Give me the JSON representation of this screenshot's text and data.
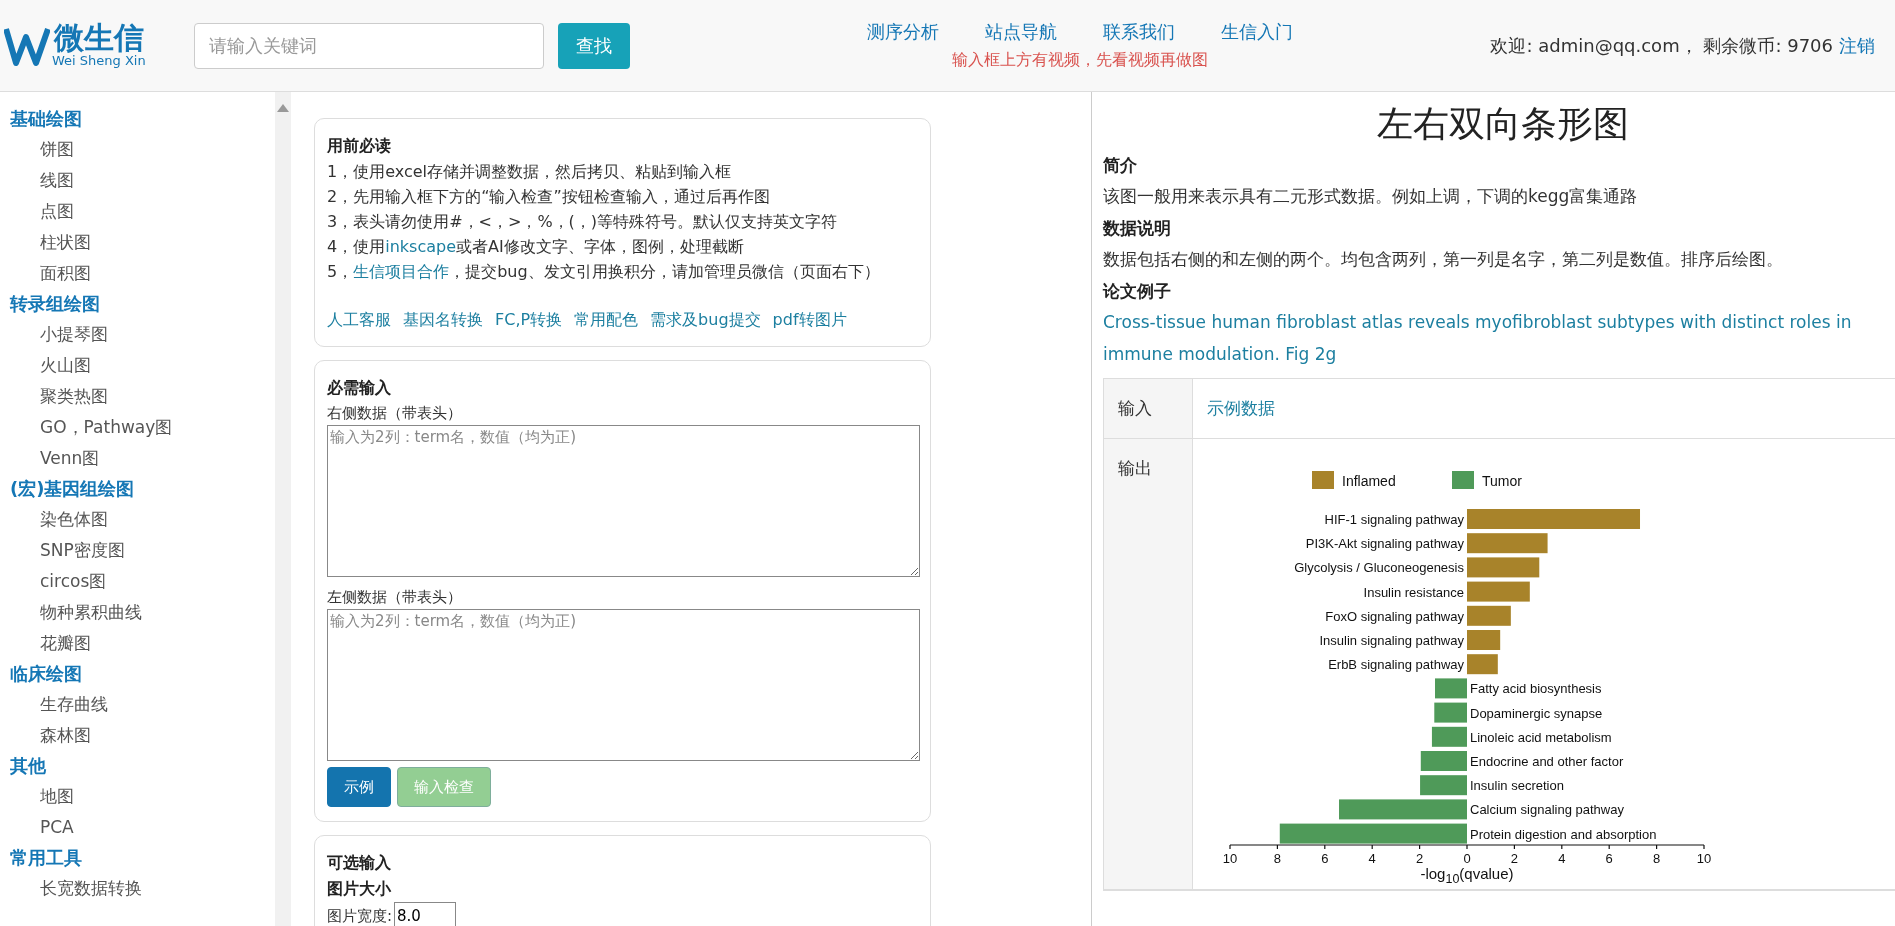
{
  "header": {
    "logo": {
      "name": "微生信",
      "subtitle": "Wei Sheng Xin"
    },
    "search": {
      "placeholder": "请输入关键词",
      "button": "查找"
    },
    "nav": [
      "测序分析",
      "站点导航",
      "联系我们",
      "生信入门"
    ],
    "notice": "输入框上方有视频，先看视频再做图",
    "welcome": "欢迎: admin@qq.com， 剩余微币: 9706",
    "logout": "注销"
  },
  "sidebar": {
    "groups": [
      {
        "title": "基础绘图",
        "items": [
          "饼图",
          "线图",
          "点图",
          "柱状图",
          "面积图"
        ]
      },
      {
        "title": "转录组绘图",
        "items": [
          "小提琴图",
          "火山图",
          "聚类热图",
          "GO，Pathway图",
          "Venn图"
        ]
      },
      {
        "title": "(宏)基因组绘图",
        "items": [
          "染色体图",
          "SNP密度图",
          "circos图",
          "物种累积曲线",
          "花瓣图"
        ]
      },
      {
        "title": "临床绘图",
        "items": [
          "生存曲线",
          "森林图"
        ]
      },
      {
        "title": "其他",
        "items": [
          "地图",
          "PCA"
        ]
      },
      {
        "title": "常用工具",
        "items": [
          "长宽数据转换"
        ]
      }
    ]
  },
  "guide": {
    "title": "用前必读",
    "lines": [
      [
        {
          "kind": "text",
          "text": "1，使用excel存储并调整数据，然后拷贝、粘贴到输入框"
        }
      ],
      [
        {
          "kind": "text",
          "text": "2，先用输入框下方的“输入检查”按钮检查输入，通过后再作图"
        }
      ],
      [
        {
          "kind": "text",
          "text": "3，表头请勿使用#，<，>，%，(，)等特殊符号。默认仅支持英文字符"
        }
      ],
      [
        {
          "kind": "text",
          "text": "4，使用"
        },
        {
          "kind": "link",
          "text": "inkscape"
        },
        {
          "kind": "text",
          "text": "或者AI修改文字、字体，图例，处理截断"
        }
      ],
      [
        {
          "kind": "text",
          "text": "5，"
        },
        {
          "kind": "link",
          "text": "生信项目合作"
        },
        {
          "kind": "text",
          "text": "，提交bug、发文引用换积分，请加管理员微信（页面右下）"
        }
      ]
    ],
    "links": [
      "人工客服",
      "基因名转换",
      "FC,P转换",
      "常用配色",
      "需求及bug提交",
      "pdf转图片"
    ]
  },
  "required": {
    "title": "必需输入",
    "fields": [
      {
        "label": "右侧数据（带表头）",
        "placeholder": "输入为2列：term名，数值（均为正)"
      },
      {
        "label": "左侧数据（带表头）",
        "placeholder": "输入为2列：term名，数值（均为正)"
      }
    ],
    "buttons": [
      {
        "label": "示例",
        "kind": "primary",
        "disabled": false
      },
      {
        "label": "输入检查",
        "kind": "success",
        "disabled": true
      }
    ]
  },
  "optional": {
    "title": "可选输入",
    "subtitle": "图片大小",
    "fields": [
      {
        "label": "图片宽度:",
        "value": "8.0"
      }
    ]
  },
  "detail": {
    "title": "左右双向条形图",
    "sections": [
      {
        "heading": "简介",
        "kind": "text",
        "text": "该图一般用来表示具有二元形式数据。例如上调，下调的kegg富集通路"
      },
      {
        "heading": "数据说明",
        "kind": "text",
        "text": "数据包括右侧的和左侧的两个。均包含两列，第一列是名字，第二列是数值。排序后绘图。"
      },
      {
        "heading": "论文例子",
        "kind": "link",
        "text": "Cross-tissue human fibroblast atlas reveals myofibroblast subtypes with distinct roles in immune modulation. Fig 2g"
      }
    ],
    "table": [
      {
        "label": "输入",
        "kind": "link",
        "text": "示例数据"
      },
      {
        "label": "输出",
        "kind": "chart",
        "chart_data": {
          "type": "bar",
          "orientation": "horizontal",
          "xlabel": "-log$_{10}$(qvalue)",
          "categories": [
            "HIF-1 signaling pathway",
            "PI3K-Akt signaling pathway",
            "Glycolysis / Gluconeogenesis",
            "Insulin resistance",
            "FoxO signaling pathway",
            "Insulin signaling pathway",
            "ErbB signaling pathway",
            "Fatty acid biosynthesis",
            "Dopaminergic synapse",
            "Linoleic acid metabolism",
            "Endocrine and other factor",
            "Insulin secretion",
            "Calcium signaling pathway",
            "Protein digestion and absorption"
          ],
          "series": [
            {
              "name": "Inflamed",
              "color": "#a8832a",
              "values": [
                7.3,
                3.4,
                3.05,
                2.65,
                1.85,
                1.4,
                1.3,
                null,
                null,
                null,
                null,
                null,
                null,
                null
              ]
            },
            {
              "name": "Tumor",
              "color": "#4f9a59",
              "values": [
                null,
                null,
                null,
                null,
                null,
                null,
                null,
                -1.35,
                -1.38,
                -1.48,
                -1.95,
                -1.98,
                -5.4,
                -7.9
              ]
            }
          ],
          "legend": true,
          "xlim": [
            -10,
            10
          ],
          "xticks": [
            {
              "value": -10,
              "label": "10"
            },
            {
              "value": -8,
              "label": "8"
            },
            {
              "value": -6,
              "label": "6"
            },
            {
              "value": -4,
              "label": "4"
            },
            {
              "value": -2,
              "label": "2"
            },
            0,
            2,
            4,
            6,
            8,
            10
          ]
        }
      }
    ]
  }
}
